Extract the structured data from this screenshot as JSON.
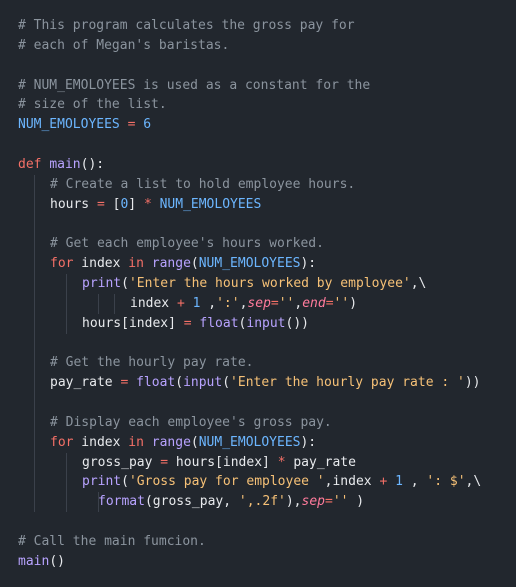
{
  "editor": {
    "lines": [
      {
        "indent": 0,
        "tokens": [
          {
            "t": "comment",
            "v": "# This program calculates the gross pay for"
          }
        ]
      },
      {
        "indent": 0,
        "tokens": [
          {
            "t": "comment",
            "v": "# each of Megan's baristas."
          }
        ]
      },
      {
        "indent": 0,
        "tokens": []
      },
      {
        "indent": 0,
        "tokens": [
          {
            "t": "comment",
            "v": "# NUM_EMOLOYEES is used as a constant for the"
          }
        ]
      },
      {
        "indent": 0,
        "tokens": [
          {
            "t": "comment",
            "v": "# size of the list."
          }
        ]
      },
      {
        "indent": 0,
        "tokens": [
          {
            "t": "const",
            "v": "NUM_EMOLOYEES"
          },
          {
            "t": "plain",
            "v": " "
          },
          {
            "t": "op",
            "v": "="
          },
          {
            "t": "plain",
            "v": " "
          },
          {
            "t": "number",
            "v": "6"
          }
        ]
      },
      {
        "indent": 0,
        "tokens": []
      },
      {
        "indent": 0,
        "tokens": [
          {
            "t": "keyword",
            "v": "def"
          },
          {
            "t": "plain",
            "v": " "
          },
          {
            "t": "func",
            "v": "main"
          },
          {
            "t": "plain",
            "v": "():"
          }
        ]
      },
      {
        "indent": 1,
        "tokens": [
          {
            "t": "comment",
            "v": "# Create a list to hold employee hours."
          }
        ]
      },
      {
        "indent": 1,
        "tokens": [
          {
            "t": "plain",
            "v": "hours "
          },
          {
            "t": "op",
            "v": "="
          },
          {
            "t": "plain",
            "v": " ["
          },
          {
            "t": "number",
            "v": "0"
          },
          {
            "t": "plain",
            "v": "] "
          },
          {
            "t": "op",
            "v": "*"
          },
          {
            "t": "plain",
            "v": " "
          },
          {
            "t": "const",
            "v": "NUM_EMOLOYEES"
          }
        ]
      },
      {
        "indent": 1,
        "tokens": []
      },
      {
        "indent": 1,
        "tokens": [
          {
            "t": "comment",
            "v": "# Get each employee's hours worked."
          }
        ]
      },
      {
        "indent": 1,
        "tokens": [
          {
            "t": "keyword",
            "v": "for"
          },
          {
            "t": "plain",
            "v": " index "
          },
          {
            "t": "keyword",
            "v": "in"
          },
          {
            "t": "plain",
            "v": " "
          },
          {
            "t": "func",
            "v": "range"
          },
          {
            "t": "plain",
            "v": "("
          },
          {
            "t": "const",
            "v": "NUM_EMOLOYEES"
          },
          {
            "t": "plain",
            "v": "):"
          }
        ]
      },
      {
        "indent": 2,
        "tokens": [
          {
            "t": "func",
            "v": "print"
          },
          {
            "t": "plain",
            "v": "("
          },
          {
            "t": "string",
            "v": "'Enter the hours worked by employee'"
          },
          {
            "t": "plain",
            "v": ",\\"
          }
        ]
      },
      {
        "indent": 4,
        "tokens": [
          {
            "t": "plain",
            "v": "index "
          },
          {
            "t": "op",
            "v": "+"
          },
          {
            "t": "plain",
            "v": " "
          },
          {
            "t": "number",
            "v": "1"
          },
          {
            "t": "plain",
            "v": " ,"
          },
          {
            "t": "string",
            "v": "':'"
          },
          {
            "t": "plain",
            "v": ","
          },
          {
            "t": "param",
            "v": "sep"
          },
          {
            "t": "op",
            "v": "="
          },
          {
            "t": "string",
            "v": "''"
          },
          {
            "t": "plain",
            "v": ","
          },
          {
            "t": "param",
            "v": "end"
          },
          {
            "t": "op",
            "v": "="
          },
          {
            "t": "string",
            "v": "''"
          },
          {
            "t": "plain",
            "v": ")"
          }
        ]
      },
      {
        "indent": 2,
        "tokens": [
          {
            "t": "plain",
            "v": "hours[index] "
          },
          {
            "t": "op",
            "v": "="
          },
          {
            "t": "plain",
            "v": " "
          },
          {
            "t": "func",
            "v": "float"
          },
          {
            "t": "plain",
            "v": "("
          },
          {
            "t": "func",
            "v": "input"
          },
          {
            "t": "plain",
            "v": "())"
          }
        ]
      },
      {
        "indent": 1,
        "tokens": []
      },
      {
        "indent": 1,
        "tokens": [
          {
            "t": "comment",
            "v": "# Get the hourly pay rate."
          }
        ]
      },
      {
        "indent": 1,
        "tokens": [
          {
            "t": "plain",
            "v": "pay_rate "
          },
          {
            "t": "op",
            "v": "="
          },
          {
            "t": "plain",
            "v": " "
          },
          {
            "t": "func",
            "v": "float"
          },
          {
            "t": "plain",
            "v": "("
          },
          {
            "t": "func",
            "v": "input"
          },
          {
            "t": "plain",
            "v": "("
          },
          {
            "t": "string",
            "v": "'Enter the hourly pay rate : '"
          },
          {
            "t": "plain",
            "v": "))"
          }
        ]
      },
      {
        "indent": 1,
        "tokens": []
      },
      {
        "indent": 1,
        "tokens": [
          {
            "t": "comment",
            "v": "# Display each employee's gross pay."
          }
        ]
      },
      {
        "indent": 1,
        "tokens": [
          {
            "t": "keyword",
            "v": "for"
          },
          {
            "t": "plain",
            "v": " index "
          },
          {
            "t": "keyword",
            "v": "in"
          },
          {
            "t": "plain",
            "v": " "
          },
          {
            "t": "func",
            "v": "range"
          },
          {
            "t": "plain",
            "v": "("
          },
          {
            "t": "const",
            "v": "NUM_EMOLOYEES"
          },
          {
            "t": "plain",
            "v": "):"
          }
        ]
      },
      {
        "indent": 2,
        "tokens": [
          {
            "t": "plain",
            "v": "gross_pay "
          },
          {
            "t": "op",
            "v": "="
          },
          {
            "t": "plain",
            "v": " hours[index] "
          },
          {
            "t": "op",
            "v": "*"
          },
          {
            "t": "plain",
            "v": " pay_rate"
          }
        ]
      },
      {
        "indent": 2,
        "tokens": [
          {
            "t": "func",
            "v": "print"
          },
          {
            "t": "plain",
            "v": "("
          },
          {
            "t": "string",
            "v": "'Gross pay for employee '"
          },
          {
            "t": "plain",
            "v": ",index "
          },
          {
            "t": "op",
            "v": "+"
          },
          {
            "t": "plain",
            "v": " "
          },
          {
            "t": "number",
            "v": "1"
          },
          {
            "t": "plain",
            "v": " , "
          },
          {
            "t": "string",
            "v": "': $'"
          },
          {
            "t": "plain",
            "v": ",\\"
          }
        ]
      },
      {
        "indent": 3,
        "tokens": [
          {
            "t": "func",
            "v": "format"
          },
          {
            "t": "plain",
            "v": "(gross_pay, "
          },
          {
            "t": "string",
            "v": "',.2f'"
          },
          {
            "t": "plain",
            "v": "),"
          },
          {
            "t": "param",
            "v": "sep"
          },
          {
            "t": "op",
            "v": "="
          },
          {
            "t": "string",
            "v": "''"
          },
          {
            "t": "plain",
            "v": " )"
          }
        ]
      },
      {
        "indent": 0,
        "tokens": []
      },
      {
        "indent": 0,
        "tokens": [
          {
            "t": "comment",
            "v": "# Call the main fumcion."
          }
        ]
      },
      {
        "indent": 0,
        "tokens": [
          {
            "t": "func",
            "v": "main"
          },
          {
            "t": "plain",
            "v": "()"
          }
        ]
      }
    ]
  }
}
